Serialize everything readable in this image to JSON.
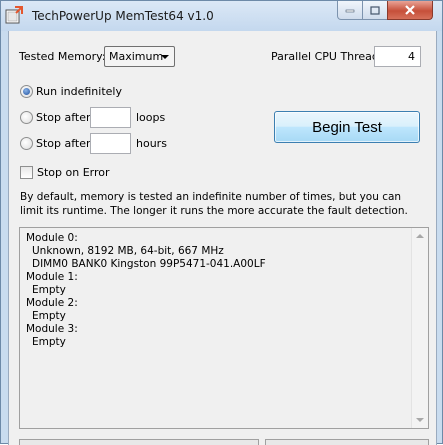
{
  "window": {
    "title": "TechPowerUp MemTest64 v1.0",
    "accent_color": "#c9dcef"
  },
  "settings": {
    "tested_memory_label": "Tested Memory:",
    "tested_memory_value": "Maximum",
    "threads_label": "Parallel CPU Threads:",
    "threads_value": "4"
  },
  "mode": {
    "run_indefinitely": "Run indefinitely",
    "stop_after_1": "Stop after",
    "loops_label": "loops",
    "stop_after_2": "Stop after",
    "hours_label": "hours",
    "selected": "run_indefinitely",
    "stop_on_error": "Stop on Error",
    "stop_on_error_checked": false
  },
  "begin_label": "Begin Test",
  "description": "By default, memory is tested an indefinite number of times, but you can limit its runtime. The longer it runs the more accurate the fault detection.",
  "modules": [
    {
      "title": "Module 0:",
      "lines": [
        "Unknown, 8192 MB, 64-bit, 667 MHz",
        "DIMM0 BANK0 Kingston 99P5471-041.A00LF"
      ]
    },
    {
      "title": "Module 1:",
      "lines": [
        "Empty"
      ]
    },
    {
      "title": "Module 2:",
      "lines": [
        "Empty"
      ]
    },
    {
      "title": "Module 3:",
      "lines": [
        "Empty"
      ]
    }
  ]
}
